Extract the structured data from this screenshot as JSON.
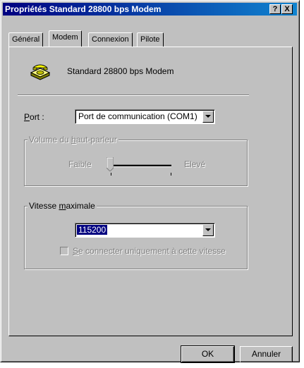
{
  "window": {
    "title": "Propriétés Standard 28800 bps Modem",
    "help_button": "?",
    "close_button": "X"
  },
  "tabs": [
    {
      "label": "Général",
      "active": false
    },
    {
      "label": "Modem",
      "active": true
    },
    {
      "label": "Connexion",
      "active": false
    },
    {
      "label": "Pilote",
      "active": false
    }
  ],
  "modem": {
    "icon": "telephone-modem-icon",
    "name": "Standard 28800 bps Modem"
  },
  "port": {
    "label_first": "P",
    "label_rest": "ort :",
    "value": "Port de communication (COM1)"
  },
  "volume": {
    "legend_pre": "Volume du ",
    "legend_accel": "h",
    "legend_post": "aut-parleur",
    "low_label": "Faible",
    "high_label": "Elevé",
    "level": 0.0,
    "enabled": false
  },
  "speed": {
    "legend_pre": "Vitesse ",
    "legend_accel": "m",
    "legend_post": "aximale",
    "value": "115200",
    "checkbox_accel": "S",
    "checkbox_label": "e connecter uniquement à cette vitesse",
    "checkbox_checked": false,
    "checkbox_enabled": false
  },
  "buttons": {
    "ok": "OK",
    "cancel": "Annuler"
  }
}
